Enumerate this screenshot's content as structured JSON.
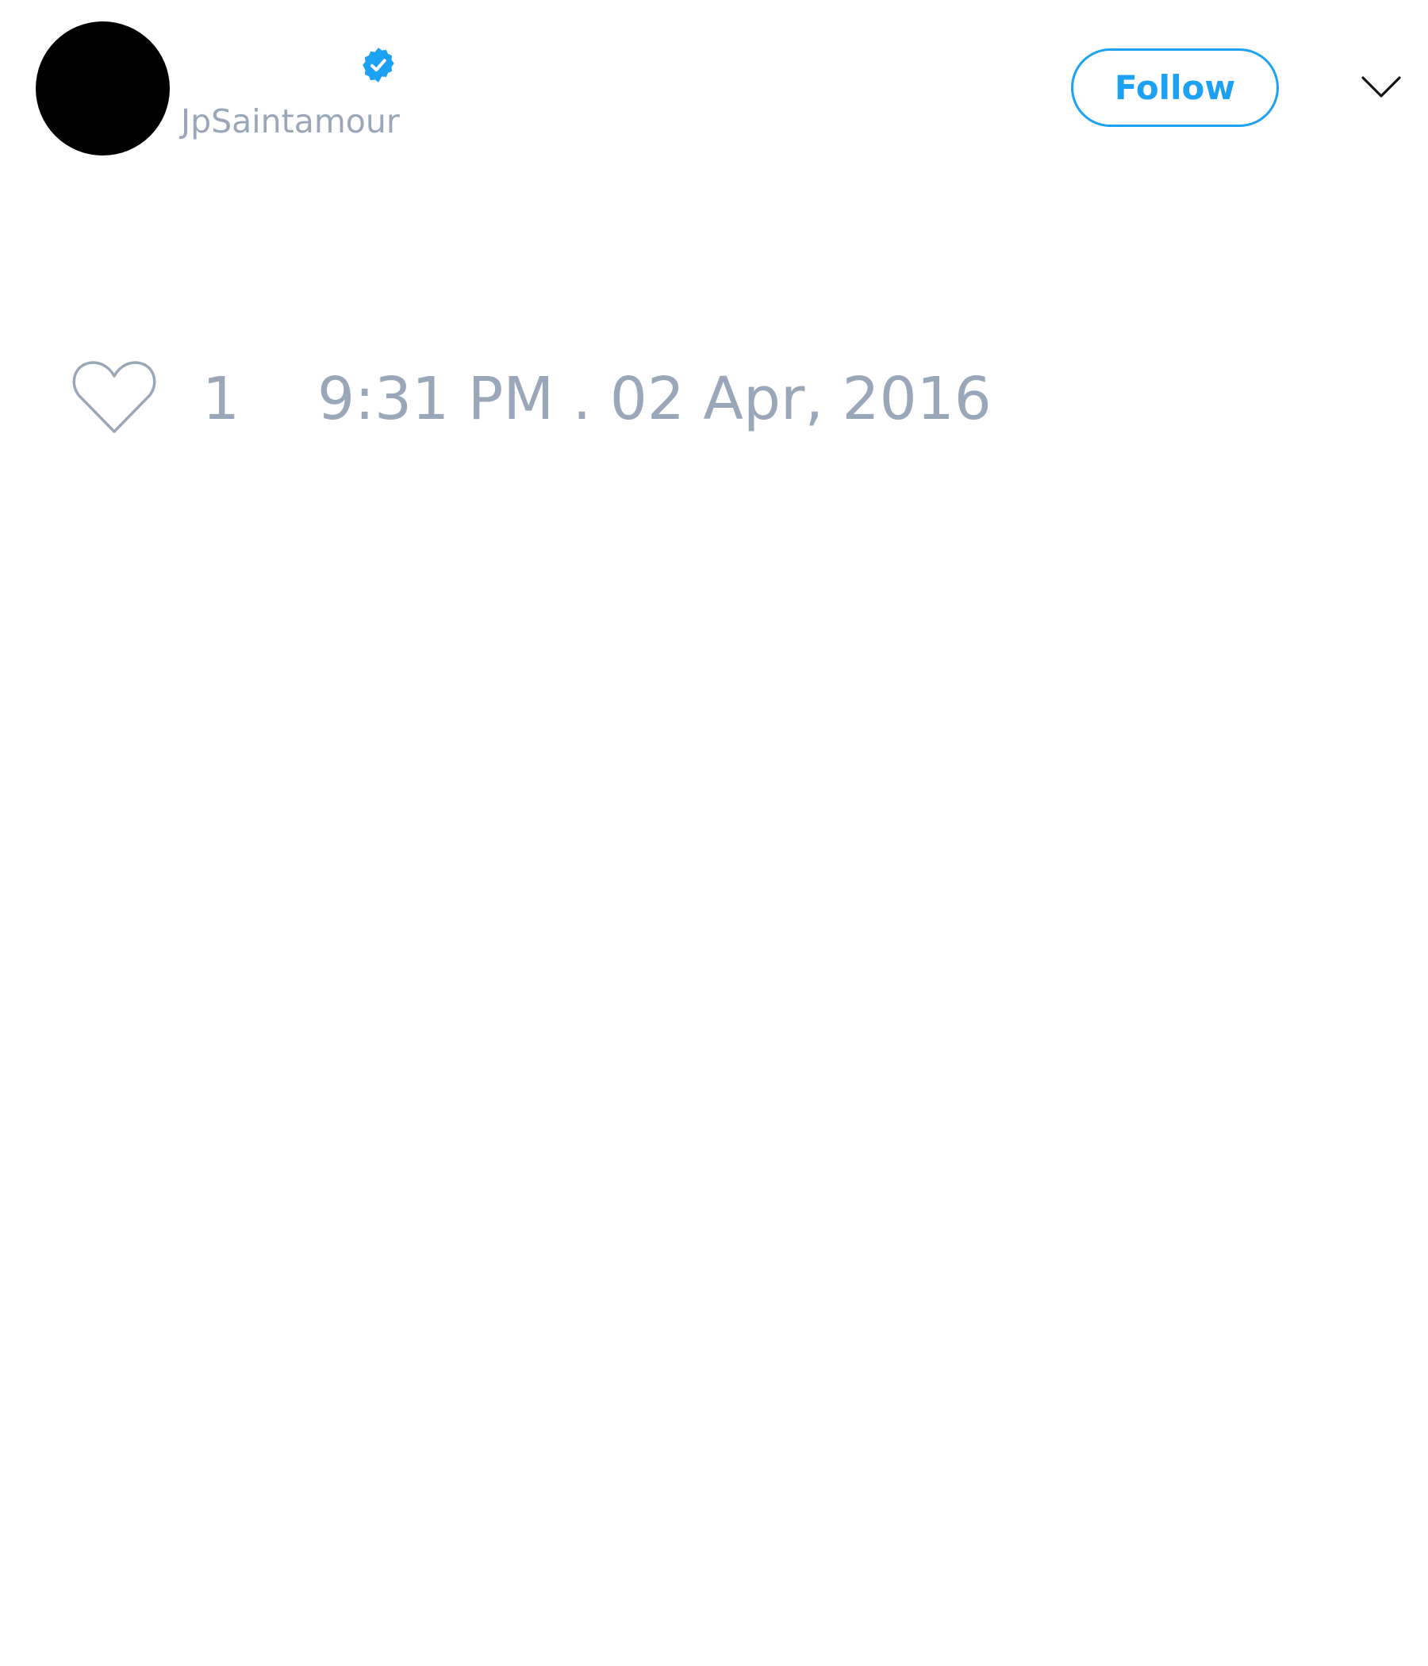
{
  "tweet": {
    "author": {
      "display_name": "",
      "username": "JpSaintamour",
      "verified": true
    },
    "follow_label": "Follow",
    "like_count": "1",
    "timestamp": "9:31 PM . 02 Apr, 2016"
  },
  "icons": {
    "verified": "verified-badge-icon",
    "menu": "chevron-down-icon",
    "like": "heart-icon"
  },
  "colors": {
    "accent": "#1da1f2",
    "muted_text": "#9aa7b8",
    "avatar": "#000000",
    "background": "#ffffff"
  }
}
